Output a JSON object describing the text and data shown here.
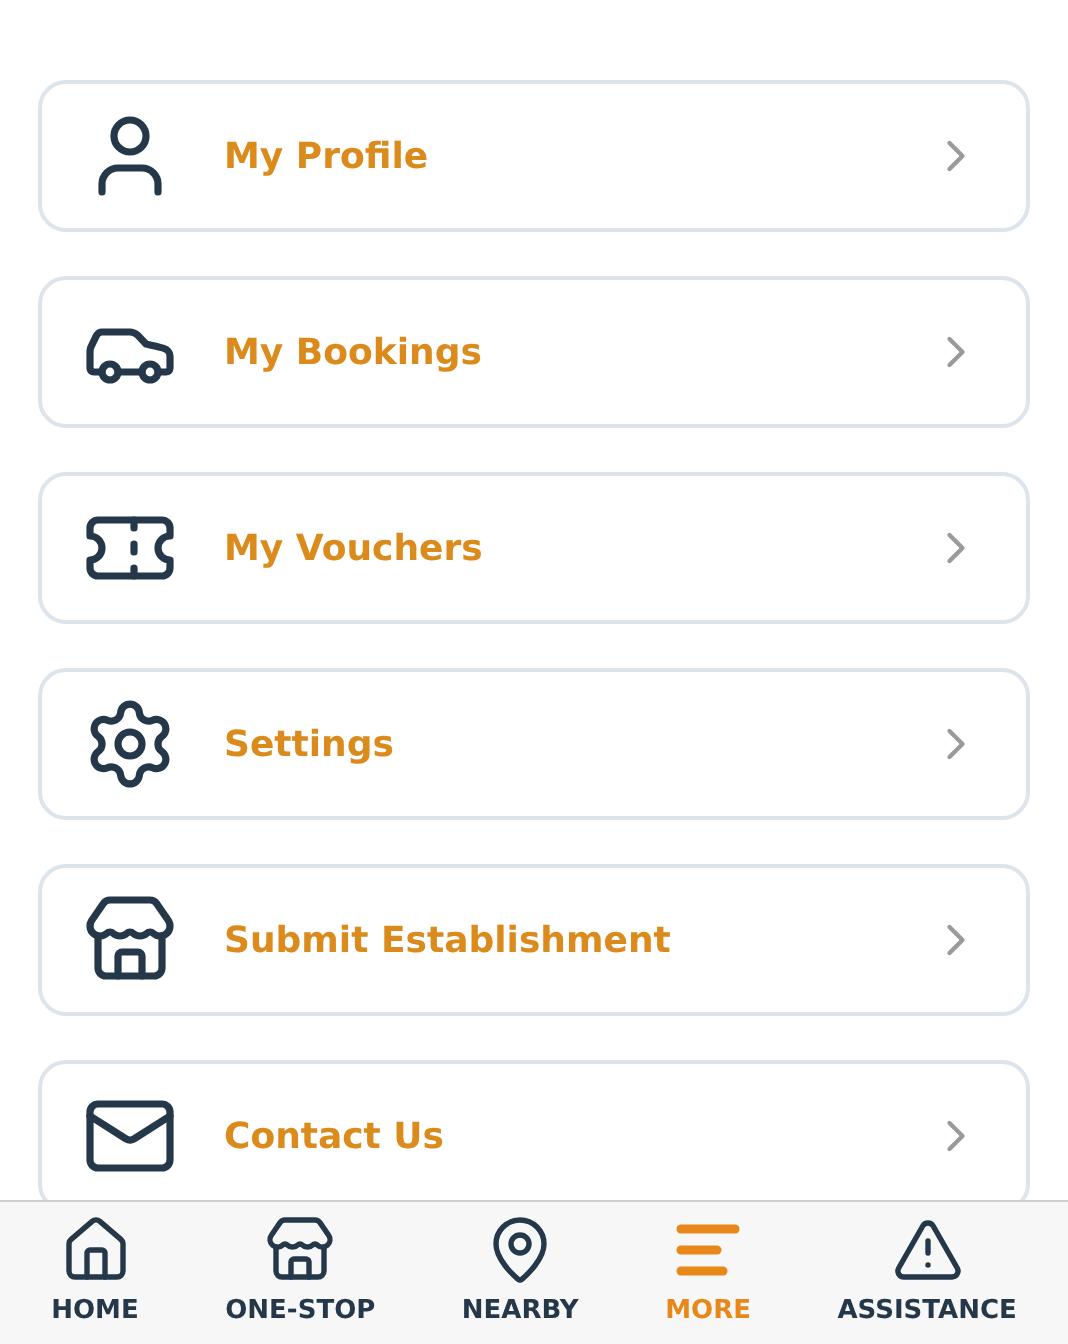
{
  "menu_items": [
    {
      "kind": "profile",
      "label": "My Profile"
    },
    {
      "kind": "bookings",
      "label": "My Bookings"
    },
    {
      "kind": "vouchers",
      "label": "My Vouchers"
    },
    {
      "kind": "settings",
      "label": "Settings"
    },
    {
      "kind": "establishment",
      "label": "Submit Establishment"
    },
    {
      "kind": "contact",
      "label": "Contact Us"
    }
  ],
  "tab_bar": [
    {
      "kind": "home",
      "label": "HOME",
      "selected": false
    },
    {
      "kind": "store",
      "label": "ONE-STOP",
      "selected": false
    },
    {
      "kind": "nearby",
      "label": "NEARBY",
      "selected": false
    },
    {
      "kind": "more",
      "label": "MORE",
      "selected": true
    },
    {
      "kind": "assistance",
      "label": "ASSISTANCE",
      "selected": false
    }
  ]
}
